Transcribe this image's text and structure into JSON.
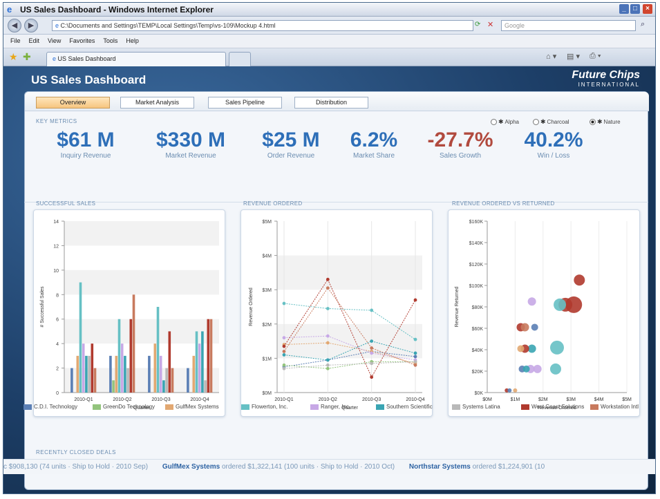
{
  "window": {
    "title": "US Sales Dashboard - Windows Internet Explorer"
  },
  "browser": {
    "address": "C:\\Documents and Settings\\TEMP\\Local Settings\\Temp\\vs-109\\Mockup 4.html",
    "search_placeholder": "Google",
    "menu": [
      "File",
      "Edit",
      "View",
      "Favorites",
      "Tools",
      "Help"
    ],
    "tab_label": "US Sales Dashboard"
  },
  "app": {
    "title": "US Sales Dashboard",
    "logo": "Future Chips",
    "logo_sub": "INTERNATIONAL"
  },
  "tabs": [
    {
      "label": "Overview",
      "active": true
    },
    {
      "label": "Market Analysis",
      "active": false
    },
    {
      "label": "Sales Pipeline",
      "active": false
    },
    {
      "label": "Distribution",
      "active": false
    }
  ],
  "key_metrics": {
    "title": "KEY METRICS",
    "options": [
      {
        "label": "Alpha",
        "selected": false
      },
      {
        "label": "Charcoal",
        "selected": false
      },
      {
        "label": "Nature",
        "selected": true
      }
    ],
    "items": [
      {
        "value": "$61 M",
        "label": "Inquiry Revenue",
        "color": "#2e6fb8"
      },
      {
        "value": "$330 M",
        "label": "Market Revenue",
        "color": "#2e6fb8"
      },
      {
        "value": "$25 M",
        "label": "Order Revenue",
        "color": "#2e6fb8"
      },
      {
        "value": "6.2%",
        "label": "Market Share",
        "color": "#2e6fb8"
      },
      {
        "value": "-27.7%",
        "label": "Sales Growth",
        "color": "#b14a3e"
      },
      {
        "value": "40.2%",
        "label": "Win / Loss",
        "color": "#2e6fb8"
      }
    ]
  },
  "charts": {
    "successful_sales_title": "SUCCESSFUL SALES",
    "revenue_ordered_title": "REVENUE ORDERED",
    "revenue_vs_returned_title": "REVENUE ORDERED VS RETURNED"
  },
  "series_meta": [
    {
      "name": "C.D.I. Technology",
      "color": "#5b7fb5"
    },
    {
      "name": "GreenDo Technology",
      "color": "#93c47d"
    },
    {
      "name": "GulfMex Systems",
      "color": "#e2a872"
    },
    {
      "name": "Flowerton, Inc.",
      "color": "#66c0c4"
    },
    {
      "name": "Ranger, Inc.",
      "color": "#c7a8e6"
    },
    {
      "name": "Southern Scientific",
      "color": "#3aa5b3"
    },
    {
      "name": "Systems Latina",
      "color": "#b9b9b9"
    },
    {
      "name": "West Coast Solutions",
      "color": "#b03a2e"
    },
    {
      "name": "Workstation Intl",
      "color": "#c87a5e"
    }
  ],
  "chart_data": [
    {
      "type": "bar",
      "title": "SUCCESSFUL SALES",
      "xlabel": "Quarter",
      "ylabel": "# Successful Sales",
      "categories": [
        "2010-Q1",
        "2010-Q2",
        "2010-Q3",
        "2010-Q4"
      ],
      "ylim": [
        0,
        14
      ],
      "yticks": [
        0,
        2,
        4,
        6,
        8,
        10,
        12,
        14
      ],
      "series": [
        {
          "name": "C.D.I. Technology",
          "values": [
            2,
            3,
            3,
            2
          ]
        },
        {
          "name": "GreenDo Technology",
          "values": [
            0,
            1,
            0,
            0
          ]
        },
        {
          "name": "GulfMex Systems",
          "values": [
            3,
            3,
            4,
            3
          ]
        },
        {
          "name": "Flowerton, Inc.",
          "values": [
            9,
            6,
            7,
            5
          ]
        },
        {
          "name": "Ranger, Inc.",
          "values": [
            4,
            4,
            3,
            4
          ]
        },
        {
          "name": "Southern Scientific",
          "values": [
            3,
            3,
            1,
            5
          ]
        },
        {
          "name": "Systems Latina",
          "values": [
            3,
            2,
            2,
            1
          ]
        },
        {
          "name": "West Coast Solutions",
          "values": [
            4,
            6,
            5,
            6
          ]
        },
        {
          "name": "Workstation Intl",
          "values": [
            2,
            8,
            2,
            6
          ]
        }
      ]
    },
    {
      "type": "line",
      "title": "REVENUE ORDERED",
      "xlabel": "Quarter",
      "ylabel": "Revenue Ordered",
      "categories": [
        "2010-Q1",
        "2010-Q2",
        "2010-Q3",
        "2010-Q4"
      ],
      "ylim": [
        0,
        5
      ],
      "yticks": [
        0,
        1,
        2,
        3,
        4,
        5
      ],
      "ytick_labels": [
        "$0M",
        "$1M",
        "$2M",
        "$3M",
        "$4M",
        "$5M"
      ],
      "series": [
        {
          "name": "C.D.I. Technology",
          "values": [
            0.75,
            0.95,
            1.2,
            1.05
          ]
        },
        {
          "name": "GreenDo Technology",
          "values": [
            0.8,
            0.7,
            0.9,
            0.9
          ]
        },
        {
          "name": "GulfMex Systems",
          "values": [
            1.4,
            1.45,
            1.2,
            0.85
          ]
        },
        {
          "name": "Flowerton, Inc.",
          "values": [
            2.6,
            2.45,
            2.4,
            1.55
          ]
        },
        {
          "name": "Ranger, Inc.",
          "values": [
            1.6,
            1.65,
            1.15,
            0.95
          ]
        },
        {
          "name": "Southern Scientific",
          "values": [
            1.1,
            0.95,
            1.5,
            1.15
          ]
        },
        {
          "name": "Systems Latina",
          "values": [
            0.7,
            0.8,
            0.85,
            0.9
          ]
        },
        {
          "name": "West Coast Solutions",
          "values": [
            1.35,
            3.3,
            0.45,
            2.7
          ]
        },
        {
          "name": "Workstation Intl",
          "values": [
            1.2,
            3.05,
            1.3,
            0.8
          ]
        }
      ]
    },
    {
      "type": "scatter",
      "title": "REVENUE ORDERED VS RETURNED",
      "xlabel": "Revenue Ordered",
      "ylabel": "Revenue Returned",
      "xlim": [
        0,
        5
      ],
      "ylim": [
        0,
        160
      ],
      "xticks": [
        0,
        1,
        2,
        3,
        4,
        5
      ],
      "xtick_labels": [
        "$0M",
        "$1M",
        "$2M",
        "$3M",
        "$4M",
        "$5M"
      ],
      "yticks": [
        0,
        20,
        40,
        60,
        80,
        100,
        120,
        140,
        160
      ],
      "ytick_labels": [
        "$0K",
        "$20K",
        "$40K",
        "$60K",
        "$80K",
        "$100K",
        "$120K",
        "$140K",
        "$160K"
      ],
      "points": [
        {
          "series": "West Coast Solutions",
          "x": 3.3,
          "y": 105,
          "size": 8
        },
        {
          "series": "West Coast Solutions",
          "x": 2.8,
          "y": 82,
          "size": 10
        },
        {
          "series": "West Coast Solutions",
          "x": 3.1,
          "y": 82,
          "size": 12
        },
        {
          "series": "Flowerton, Inc.",
          "x": 2.6,
          "y": 82,
          "size": 9
        },
        {
          "series": "Ranger, Inc.",
          "x": 1.6,
          "y": 85,
          "size": 6
        },
        {
          "series": "C.D.I. Technology",
          "x": 1.7,
          "y": 61,
          "size": 5
        },
        {
          "series": "West Coast Solutions",
          "x": 1.2,
          "y": 61,
          "size": 6
        },
        {
          "series": "Workstation Intl",
          "x": 1.35,
          "y": 61,
          "size": 6
        },
        {
          "series": "Flowerton, Inc.",
          "x": 2.5,
          "y": 42,
          "size": 10
        },
        {
          "series": "Southern Scientific",
          "x": 1.6,
          "y": 41,
          "size": 6
        },
        {
          "series": "West Coast Solutions",
          "x": 1.35,
          "y": 41,
          "size": 6
        },
        {
          "series": "GulfMex Systems",
          "x": 1.2,
          "y": 41,
          "size": 5
        },
        {
          "series": "Flowerton, Inc.",
          "x": 2.45,
          "y": 22,
          "size": 8
        },
        {
          "series": "Ranger, Inc.",
          "x": 1.55,
          "y": 22,
          "size": 6
        },
        {
          "series": "Ranger, Inc.",
          "x": 1.8,
          "y": 22,
          "size": 6
        },
        {
          "series": "C.D.I. Technology",
          "x": 1.25,
          "y": 22,
          "size": 5
        },
        {
          "series": "Southern Scientific",
          "x": 1.4,
          "y": 22,
          "size": 5
        },
        {
          "series": "West Coast Solutions",
          "x": 0.7,
          "y": 2,
          "size": 3
        },
        {
          "series": "C.D.I. Technology",
          "x": 0.8,
          "y": 2,
          "size": 3
        },
        {
          "series": "GulfMex Systems",
          "x": 1.0,
          "y": 2,
          "size": 3
        }
      ]
    }
  ],
  "recent_deals": {
    "title": "RECENTLY CLOSED DEALS",
    "items": [
      {
        "company": "",
        "text": "c $908,130 (74 units · Ship to Hold · 2010 Sep)"
      },
      {
        "company": "GulfMex Systems",
        "text": " ordered $1,322,141 (100 units · Ship to Hold · 2010 Oct)"
      },
      {
        "company": "Northstar Systems",
        "text": " ordered $1,224,901 (10"
      }
    ]
  }
}
